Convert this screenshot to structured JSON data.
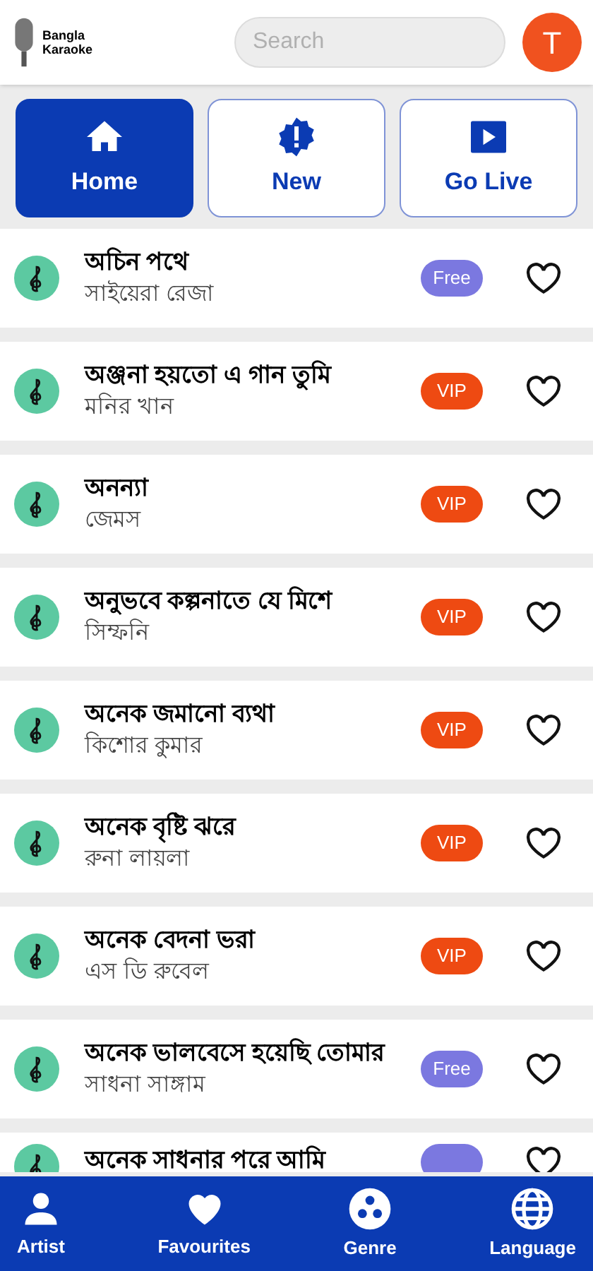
{
  "header": {
    "logo_text": "Bangla Karaoke",
    "search": {
      "placeholder": "Search"
    },
    "avatar": "T"
  },
  "tabs": [
    {
      "label": "Home",
      "selected": true
    },
    {
      "label": "New",
      "selected": false
    },
    {
      "label": "Go Live",
      "selected": false
    }
  ],
  "songs": [
    {
      "title": "অচিন পথে",
      "artist": "সাইয়েরা রেজা",
      "badge": {
        "kind": "free",
        "label": "Free"
      },
      "favourite": false
    },
    {
      "title": "অঞ্জনা হয়তো এ গান তুমি",
      "artist": "মনির খান",
      "badge": {
        "kind": "vip",
        "label": "VIP"
      },
      "favourite": false
    },
    {
      "title": "অনন্যা",
      "artist": "জেমস",
      "badge": {
        "kind": "vip",
        "label": "VIP"
      },
      "favourite": false
    },
    {
      "title": "অনুভবে কল্পনাতে যে মিশে",
      "artist": "সিম্ফনি",
      "badge": {
        "kind": "vip",
        "label": "VIP"
      },
      "favourite": false
    },
    {
      "title": "অনেক জমানো ব্যথা",
      "artist": "কিশোর কুমার",
      "badge": {
        "kind": "vip",
        "label": "VIP"
      },
      "favourite": false
    },
    {
      "title": "অনেক বৃষ্টি ঝরে",
      "artist": "রুনা লায়লা",
      "badge": {
        "kind": "vip",
        "label": "VIP"
      },
      "favourite": false
    },
    {
      "title": "অনেক বেদনা ভরা",
      "artist": "এস ডি রুবেল",
      "badge": {
        "kind": "vip",
        "label": "VIP"
      },
      "favourite": false
    },
    {
      "title": "অনেক ভালবেসে হয়েছি তোমার",
      "artist": "সাধনা সাঙ্গাম",
      "badge": {
        "kind": "free",
        "label": "Free"
      },
      "favourite": false
    },
    {
      "title": "অনেক সাধনার পরে আমি",
      "badge": {
        "kind": "free"
      },
      "favourite": false
    }
  ],
  "bottom_nav": [
    {
      "label": "Artist"
    },
    {
      "label": "Favourites"
    },
    {
      "label": "Genre"
    },
    {
      "label": "Language"
    }
  ]
}
